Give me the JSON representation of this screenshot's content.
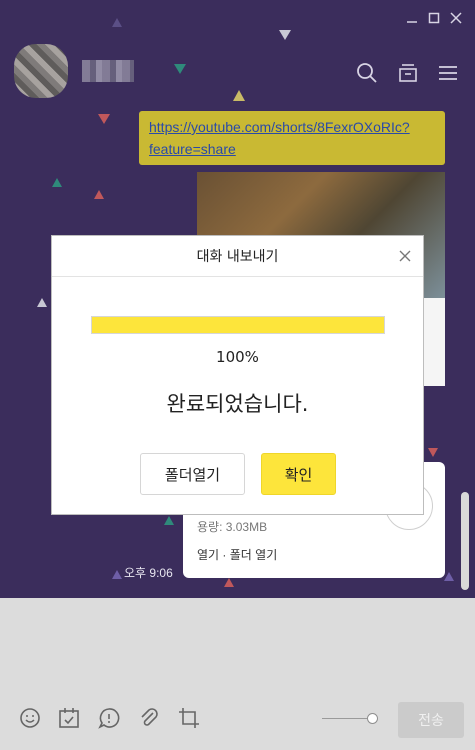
{
  "colors": {
    "chat_background": "#3b2d5c",
    "accent_yellow": "#fde53b",
    "link_bubble": "#c9b933",
    "link_text": "#2a4aa8",
    "input_area": "#dcdcdc"
  },
  "window_controls": {
    "minimize_icon": "minimize-icon",
    "maximize_icon": "maximize-icon",
    "close_icon": "close-icon"
  },
  "header": {
    "icons": [
      "search-icon",
      "drawer-icon",
      "menu-icon"
    ]
  },
  "messages": {
    "link": "https://youtube.com/shorts/8FexrOXoRIc?feature=share",
    "file_size": "용량: 3.03MB",
    "file_actions": "열기 · 폴더 열기",
    "timestamp": "오후 9:06"
  },
  "dialog": {
    "title": "대화 내보내기",
    "progress": 100,
    "percent_text": "100%",
    "message": "완료되었습니다.",
    "open_folder_label": "폴더열기",
    "ok_label": "확인"
  },
  "toolbar": {
    "icons": [
      "emoji-icon",
      "calendar-icon",
      "chat-bubble-icon",
      "attachment-icon",
      "crop-icon"
    ],
    "send_label": "전송"
  }
}
